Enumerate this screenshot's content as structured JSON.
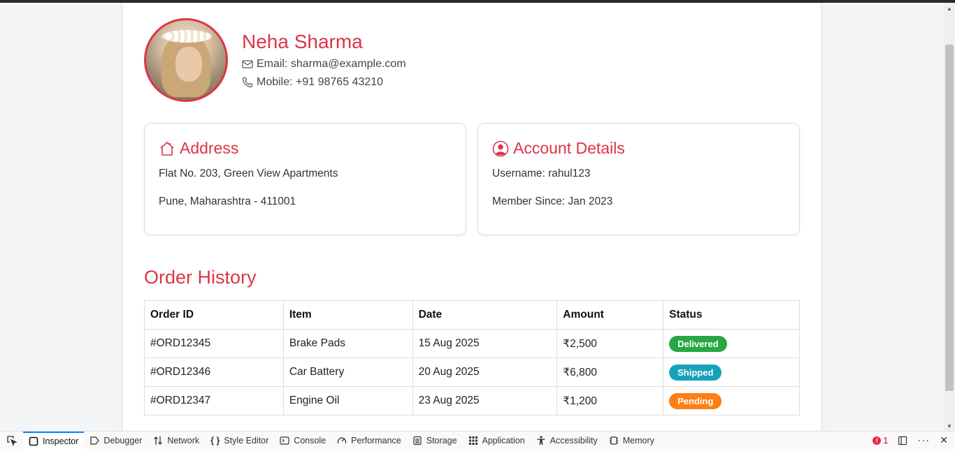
{
  "profile": {
    "name": "Neha Sharma",
    "email_text": "Email: sharma@example.com",
    "mobile_text": "Mobile: +91 98765 43210"
  },
  "address": {
    "title": "Address",
    "line1": "Flat No. 203, Green View Apartments",
    "line2": "Pune, Maharashtra - 411001"
  },
  "account": {
    "title": "Account Details",
    "username_text": "Username: rahul123",
    "member_since_text": "Member Since: Jan 2023"
  },
  "orders": {
    "title": "Order History",
    "headers": [
      "Order ID",
      "Item",
      "Date",
      "Amount",
      "Status"
    ],
    "rows": [
      {
        "id": "#ORD12345",
        "item": "Brake Pads",
        "date": "15 Aug 2025",
        "amount": "₹2,500",
        "status": "Delivered",
        "status_color": "#28a745"
      },
      {
        "id": "#ORD12346",
        "item": "Car Battery",
        "date": "20 Aug 2025",
        "amount": "₹6,800",
        "status": "Shipped",
        "status_color": "#17a2b8"
      },
      {
        "id": "#ORD12347",
        "item": "Engine Oil",
        "date": "23 Aug 2025",
        "amount": "₹1,200",
        "status": "Pending",
        "status_color": "#fd7e14"
      }
    ]
  },
  "theme": {
    "accent": "#dc3545"
  },
  "devtools": {
    "tabs": [
      "Inspector",
      "Debugger",
      "Network",
      "Style Editor",
      "Console",
      "Performance",
      "Storage",
      "Application",
      "Accessibility",
      "Memory"
    ],
    "error_count": "1"
  }
}
